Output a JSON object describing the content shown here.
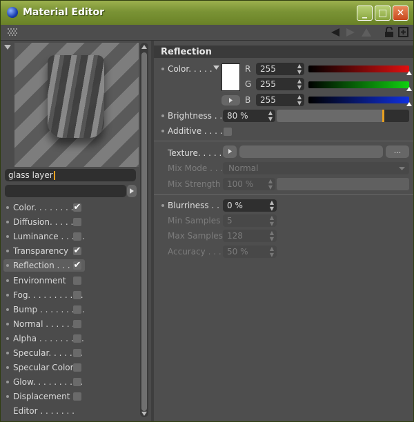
{
  "window": {
    "title": "Material Editor"
  },
  "titlebar_buttons": {
    "minimize": "_",
    "maximize": "□",
    "close": "✕"
  },
  "left": {
    "name_field": "glass layer",
    "channels": [
      {
        "label": "Color. . . . . . . . .",
        "checked": true
      },
      {
        "label": "Diffusion. . . . . .",
        "checked": false
      },
      {
        "label": "Luminance . . . . .",
        "checked": false
      },
      {
        "label": "Transparency",
        "checked": true
      },
      {
        "label": "Reflection . . . .",
        "checked": true
      },
      {
        "label": "Environment",
        "checked": false
      },
      {
        "label": "Fog. . . . . . . . . . .",
        "checked": false
      },
      {
        "label": "Bump . . . . . . . . .",
        "checked": false
      },
      {
        "label": "Normal . . . . . . .",
        "checked": false
      },
      {
        "label": "Alpha . . . . . . . . .",
        "checked": false
      },
      {
        "label": "Specular. . . . . . .",
        "checked": false
      },
      {
        "label": "Specular Color",
        "checked": false
      },
      {
        "label": "Glow. . . . . . . . . .",
        "checked": false
      },
      {
        "label": "Displacement",
        "checked": false
      },
      {
        "label": "Editor . . . . . . .",
        "checked": null
      }
    ],
    "checkmark": "✔"
  },
  "right": {
    "section_title": "Reflection",
    "color_label": "Color. . . . .",
    "r_label": "R",
    "g_label": "G",
    "b_label": "B",
    "r_value": "255",
    "g_value": "255",
    "b_value": "255",
    "r_level": 1.0,
    "g_level": 1.0,
    "b_level": 1.0,
    "brightness_label": "Brightness . . .",
    "brightness_value": "80 %",
    "brightness_level": 0.8,
    "additive_label": "Additive . . . .",
    "texture_label": "Texture. . . . .",
    "texture_more": "...",
    "mix_mode_label": "Mix Mode . . .",
    "mix_mode_value": "Normal",
    "mix_strength_label": "Mix Strength",
    "mix_strength_value": "100 %",
    "blurriness_label": "Blurriness . . .",
    "blurriness_value": "0 %",
    "min_samples_label": "Min Samples",
    "min_samples_value": "5",
    "max_samples_label": "Max Samples",
    "max_samples_value": "128",
    "accuracy_label": "Accuracy . . . .",
    "accuracy_value": "50 %"
  },
  "colors": {
    "accent": "#e8a020",
    "red": "#e01010",
    "green": "#10d010",
    "blue": "#1030e0"
  }
}
